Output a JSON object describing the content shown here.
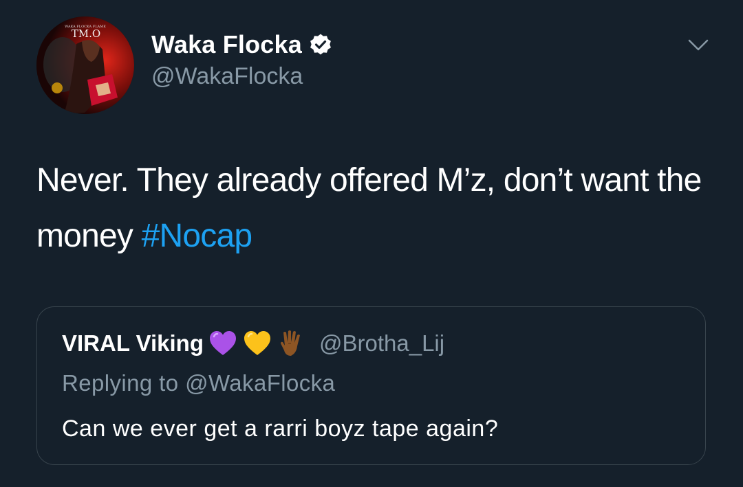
{
  "author": {
    "name": "Waka Flocka",
    "handle": "@WakaFlocka",
    "avatar_label": "TM.O",
    "avatar_small_text": "WAKA FLOCKA FLAME"
  },
  "tweet": {
    "text": "Never. They already offered M’z, don’t want the money ",
    "hashtag": "#Nocap"
  },
  "quoted": {
    "name": "VIRAL Viking",
    "emojis": [
      "purple-heart-icon",
      "yellow-heart-icon",
      "vulcan-salute-icon"
    ],
    "handle": "@Brotha_Lij",
    "replying_to": "Replying to @WakaFlocka",
    "text": "Can we ever get a rarri boyz tape again?"
  },
  "colors": {
    "background": "#15202b",
    "text": "#ffffff",
    "secondary": "#8899a6",
    "link": "#1da1f2",
    "border": "#38444d"
  }
}
